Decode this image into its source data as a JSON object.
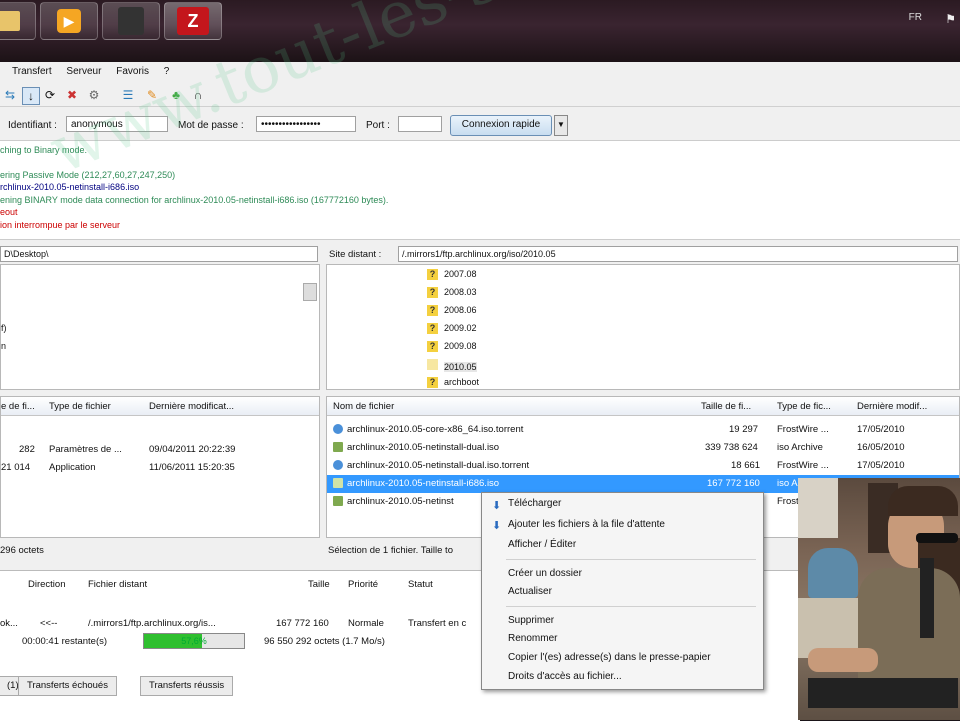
{
  "taskbar": {
    "lang": "FR",
    "flag": "⚑"
  },
  "menu": [
    "Transfert",
    "Serveur",
    "Favoris",
    "?"
  ],
  "quickconnect": {
    "user_label": "Identifiant :",
    "user_value": "anonymous",
    "pass_label": "Mot de passe :",
    "pass_value": "•••••••••••••••••",
    "port_label": "Port :",
    "port_value": "",
    "connect_label": "Connexion rapide",
    "dropdown": "▼"
  },
  "log": [
    {
      "text": "ching to Binary mode.",
      "color": "#2e8b57"
    },
    {
      "text": "",
      "color": "#000"
    },
    {
      "text": "ering Passive Mode (212,27,60,27,247,250)",
      "color": "#2e8b57"
    },
    {
      "text": "rchlinux-2010.05-netinstall-i686.iso",
      "color": "#000080"
    },
    {
      "text": "ening BINARY mode data connection for archlinux-2010.05-netinstall-i686.iso (167772160 bytes).",
      "color": "#2e8b57"
    },
    {
      "text": "eout",
      "color": "#cc0000"
    },
    {
      "text": "ion interrompue par le serveur",
      "color": "#cc0000"
    }
  ],
  "local": {
    "path": "D\\Desktop\\",
    "tree": [
      "f)",
      "n"
    ],
    "headers": [
      "e de fi...",
      "Type de fichier",
      "Dernière modificat..."
    ],
    "rows": [
      {
        "size": "282",
        "type": "Paramètres de ...",
        "date": "09/04/2011 20:22:39"
      },
      {
        "size": "21 014",
        "type": "Application",
        "date": "11/06/2011 15:20:35"
      }
    ],
    "status": "296 octets"
  },
  "remote": {
    "label": "Site distant :",
    "path": "/.mirrors1/ftp.archlinux.org/iso/2010.05",
    "tree": [
      "2007.08",
      "2008.03",
      "2008.06",
      "2009.02",
      "2009.08",
      "2010.05",
      "archboot"
    ],
    "headers": [
      "Nom de fichier",
      "Taille de fi...",
      "Type de fic...",
      "Dernière modif..."
    ],
    "rows": [
      {
        "name": "archlinux-2010.05-core-x86_64.iso.torrent",
        "size": "19 297",
        "type": "FrostWire ...",
        "date": "17/05/2010"
      },
      {
        "name": "archlinux-2010.05-netinstall-dual.iso",
        "size": "339 738 624",
        "type": "iso Archive",
        "date": "16/05/2010"
      },
      {
        "name": "archlinux-2010.05-netinstall-dual.iso.torrent",
        "size": "18 661",
        "type": "FrostWire ...",
        "date": "17/05/2010"
      },
      {
        "name": "archlinux-2010.05-netinstall-i686.iso",
        "size": "167 772 160",
        "type": "iso A",
        "date": ""
      },
      {
        "name": "archlinux-2010.05-netinst",
        "size": "",
        "type": "Frost",
        "date": ""
      }
    ],
    "status": "Sélection de 1 fichier. Taille to"
  },
  "queue": {
    "headers": [
      "Direction",
      "Fichier distant",
      "Taille",
      "Priorité",
      "Statut"
    ],
    "row": {
      "server": "ok...",
      "dir": "<<--",
      "file": "/.mirrors1/ftp.archlinux.org/is...",
      "size": "167 772 160",
      "prio": "Normale",
      "status": "Transfert en c"
    },
    "elapsed": "00:00:41 restante(s)",
    "progress_pct": 57.6,
    "progress_text": "57,6%",
    "transferred": "96 550 292 octets (1.7 Mo/s)",
    "tabs": [
      "(1)",
      "Transferts échoués",
      "Transferts réussis"
    ]
  },
  "context_menu": {
    "group1": [
      "Télécharger",
      "Ajouter les fichiers à la file d'attente",
      "Afficher / Éditer"
    ],
    "group2": [
      "Créer un dossier",
      "Actualiser"
    ],
    "group3": [
      "Supprimer",
      "Renommer",
      "Copier l'(es) adresse(s) dans le presse-papier",
      "Droits d'accès au fichier..."
    ]
  }
}
